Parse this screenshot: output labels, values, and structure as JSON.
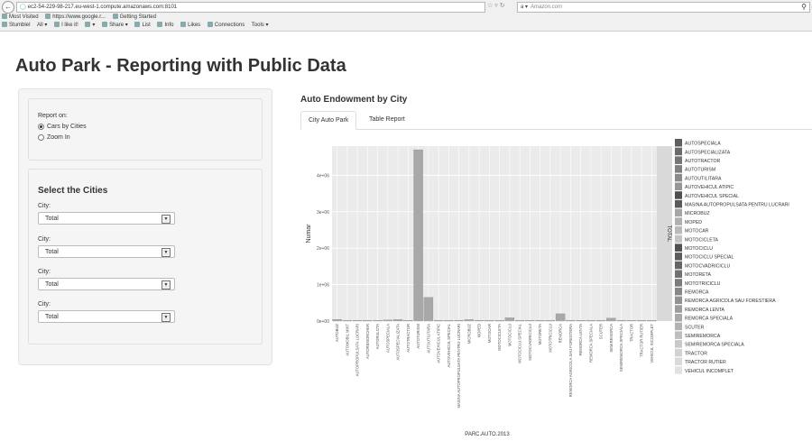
{
  "browser": {
    "url": "ec2-54-229-98-217.eu-west-1.compute.amazonaws.com:8101",
    "search_placeholder": "Amazon.com",
    "bookmarks": [
      "Most Visited",
      "https://www.google.r...",
      "Getting Started"
    ],
    "toolbar": [
      "StumbleI",
      "All ▾",
      "I like it!",
      "▾",
      "Share ▾",
      "List",
      "Info",
      "Likes",
      "Connections",
      "Tools ▾"
    ]
  },
  "page": {
    "title": "Auto Park - Reporting with Public Data"
  },
  "sidebar": {
    "report_label": "Report on:",
    "report_options": [
      {
        "label": "Cars by Cities",
        "selected": true
      },
      {
        "label": "Zoom In",
        "selected": false
      }
    ],
    "cities_heading": "Select the Cities",
    "city_label": "City:",
    "city_values": [
      "Total",
      "Total",
      "Total",
      "Total"
    ]
  },
  "main": {
    "chart_title": "Auto Endowment by City",
    "tabs": [
      {
        "label": "City Auto Park",
        "active": true
      },
      {
        "label": "Table Report",
        "active": false
      }
    ]
  },
  "chart_data": {
    "type": "bar",
    "xlabel": "PARC.AUTO.2013",
    "ylabel": "Numar",
    "facet_label": "TOTAL",
    "ylim": [
      0,
      4800000
    ],
    "yticks": [
      "0e+00",
      "1e+06",
      "2e+06",
      "3e+06",
      "4e+06"
    ],
    "grid": true,
    "legend_position": "right",
    "categories": [
      "AUTOBUZ",
      "AUTOMOBIL MIXT",
      "AUTOPROPULSATA LUCRARI",
      "AUTOREMORCHER",
      "AUTORULOTA",
      "AUTOSPECIALA",
      "AUTOSPECIALIZATA",
      "AUTOTRACTOR",
      "AUTOTURISM",
      "AUTOUTILITARA",
      "AUTOVEHICUL ATIPIC",
      "AUTOVEHICUL SPECIAL",
      "MASINA AUTOPROPULSATA PENTRU LUCRARI",
      "MICROBUZ",
      "MOPED",
      "MOTOCAR",
      "MOTOCICLETA",
      "MOTOCICLU",
      "MOTOCICLU SPECIAL",
      "MOTOCVADRICICLU",
      "MOTORETA",
      "MOTOTRICICLU",
      "REMORCA",
      "REMORCA AGRICOLA SAU FORESTIERA",
      "REMORCA LENTA",
      "REMORCA SPECIALA",
      "SCUTER",
      "SEMIREMORCA",
      "SEMIREMORCA SPECIALA",
      "TRACTOR",
      "TRACTOR RUTIER",
      "VEHICUL INCOMPLET"
    ],
    "values": [
      45000,
      3000,
      2000,
      1000,
      9000,
      30000,
      42000,
      20000,
      4700000,
      650000,
      500,
      8000,
      2000,
      40000,
      3000,
      1000,
      20000,
      90000,
      500,
      1000,
      1000,
      1000,
      200000,
      2000,
      1000,
      5000,
      5000,
      80000,
      2000,
      8000,
      20000,
      1000
    ],
    "legend": [
      "AUTOSPECIALA",
      "AUTOSPECIALIZATA",
      "AUTOTRACTOR",
      "AUTOTURISM",
      "AUTOUTILITARA",
      "AUTOVEHICUL ATIPIC",
      "AUTOVEHICUL SPECIAL",
      "MASINA AUTOPROPULSATA PENTRU LUCRARI",
      "MICROBUZ",
      "MOPED",
      "MOTOCAR",
      "MOTOCICLETA",
      "MOTOCICLU",
      "MOTOCICLU SPECIAL",
      "MOTOCVADRICICLU",
      "MOTORETA",
      "MOTOTRICICLU",
      "REMORCA",
      "REMORCA AGRICOLA SAU FORESTIERA",
      "REMORCA LENTA",
      "REMORCA SPECIALA",
      "SCUTER",
      "SEMIREMORCA",
      "SEMIREMORCA SPECIALA",
      "TRACTOR",
      "TRACTOR RUTIER",
      "VEHICUL INCOMPLET"
    ],
    "legend_colors": [
      "#5e5e5e",
      "#6a6a6a",
      "#757575",
      "#808080",
      "#8b8b8b",
      "#969696",
      "#4f4f4f",
      "#5a5a5a",
      "#a6a6a6",
      "#b0b0b0",
      "#bababa",
      "#c4c4c4",
      "#505050",
      "#5b5b5b",
      "#666666",
      "#717171",
      "#7c7c7c",
      "#878787",
      "#929292",
      "#9d9d9d",
      "#a8a8a8",
      "#b3b3b3",
      "#bebebe",
      "#c9c9c9",
      "#d2d2d2",
      "#dadada",
      "#e2e2e2"
    ]
  }
}
